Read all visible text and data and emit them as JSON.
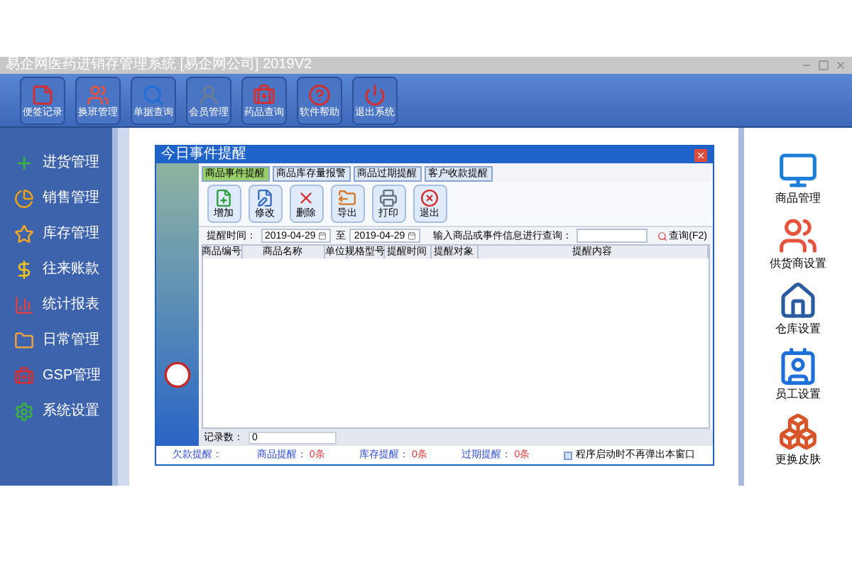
{
  "window": {
    "title": "易企网医药进销存管理系统 [易企网公司] 2019V2"
  },
  "toolbar": [
    {
      "label": "便签记录"
    },
    {
      "label": "换班管理"
    },
    {
      "label": "单据查询"
    },
    {
      "label": "会员管理"
    },
    {
      "label": "药品查询"
    },
    {
      "label": "软件帮助"
    },
    {
      "label": "退出系统"
    }
  ],
  "sidebar": {
    "items": [
      {
        "label": "进货管理"
      },
      {
        "label": "销售管理"
      },
      {
        "label": "库存管理"
      },
      {
        "label": "往来账款"
      },
      {
        "label": "统计报表"
      },
      {
        "label": "日常管理"
      },
      {
        "label": "GSP管理"
      },
      {
        "label": "系统设置"
      }
    ]
  },
  "dialog": {
    "title": "今日事件提醒",
    "tabs": [
      {
        "label": "商品事件提醒",
        "selected": true
      },
      {
        "label": "商品库存量报警",
        "selected": false
      },
      {
        "label": "商品过期提醒",
        "selected": false
      },
      {
        "label": "客户收款提醒",
        "selected": false
      }
    ],
    "actions": [
      {
        "label": "增加"
      },
      {
        "label": "修改"
      },
      {
        "label": "删除"
      },
      {
        "label": "导出"
      },
      {
        "label": "打印"
      },
      {
        "label": "退出"
      }
    ],
    "filter": {
      "label": "提醒时间：",
      "date_from": "2019-04-29",
      "separator": "至",
      "date_to": "2019-04-29",
      "search_label": "输入商品或事件信息进行查询：",
      "query_button": "查询(F2)"
    },
    "table": {
      "columns": [
        "商品编号",
        "商品名称",
        "单位",
        "规格型号",
        "提醒时间",
        "提醒对象",
        "提醒内容"
      ]
    },
    "record_label": "记录数：",
    "record_count": "0",
    "status": [
      {
        "label": "欠款提醒："
      },
      {
        "label": "商品提醒：",
        "value": "0条"
      },
      {
        "label": "库存提醒：",
        "value": "0条"
      },
      {
        "label": "过期提醒：",
        "value": "0条"
      }
    ],
    "startup_checkbox": {
      "label": "程序启动时不再弹出本窗口",
      "checked": false
    }
  },
  "right_panel": {
    "items": [
      {
        "label": "商品管理"
      },
      {
        "label": "供货商设置"
      },
      {
        "label": "仓库设置"
      },
      {
        "label": "员工设置"
      },
      {
        "label": "更换皮肤"
      }
    ]
  }
}
